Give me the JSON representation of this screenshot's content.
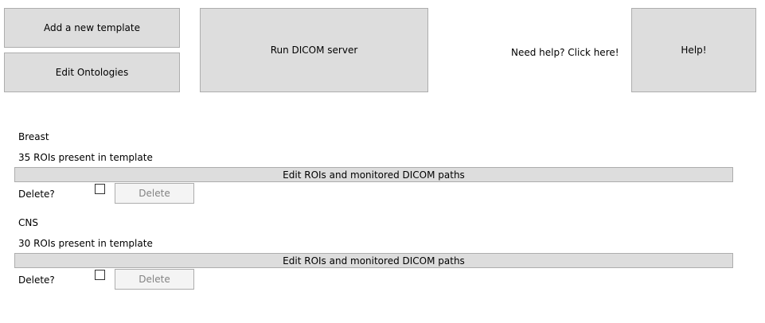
{
  "toolbar": {
    "add_template_label": "Add a new template",
    "edit_ontologies_label": "Edit Ontologies",
    "run_dicom_label": "Run DICOM server",
    "need_help_text": "Need help? Click here!",
    "help_label": "Help!"
  },
  "templates": [
    {
      "name": "Breast",
      "roi_count_text": "35 ROIs present in template",
      "edit_label": "Edit ROIs and monitored DICOM paths",
      "delete_question": "Delete?",
      "delete_checked": false,
      "delete_label": "Delete"
    },
    {
      "name": "CNS",
      "roi_count_text": "30 ROIs present in template",
      "edit_label": "Edit ROIs and monitored DICOM paths",
      "delete_question": "Delete?",
      "delete_checked": false,
      "delete_label": "Delete"
    }
  ]
}
